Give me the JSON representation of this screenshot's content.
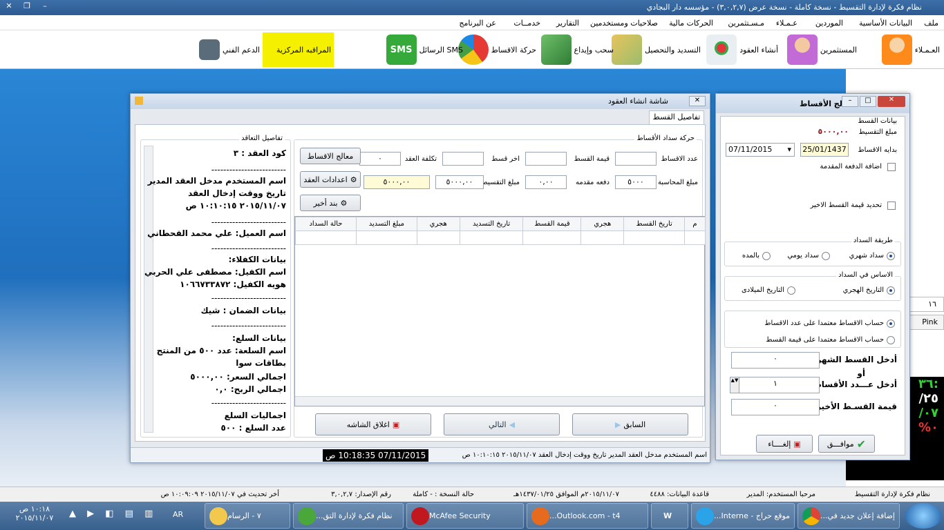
{
  "app": {
    "title": "نظام فكرة لإدارة التقسيط - نسخة كاملة - نسخة عرض (٣,٠,٢,٧) - مؤسسه دار البجادي"
  },
  "menu": [
    "ملف",
    "البيانات الأساسية",
    "الموردين",
    "عـمـلاء",
    "مـسـتثمرين",
    "الحركات مالية",
    "صلاحيات ومستخدمين",
    "التقارير",
    "خدمــات",
    "عن البرنامج"
  ],
  "toolbar": {
    "customers": "العـمـلاء",
    "investors": "المستثمرين",
    "contracts": "أنشاء العقود",
    "payment": "التسديد والتحصيل",
    "withdraw": "سحب وإيداع",
    "installments": "حركة الاقساط",
    "sms": "الرسائل SMS",
    "monitor": "المراقبه المركزية",
    "support": "الدعم الفني",
    "sms_icon": "SMS"
  },
  "contract_window": {
    "title": "شاشة انشاء العقود",
    "tab": "تفاصيل القسط",
    "contract_group": "تفاصيل التعاقد",
    "code": "كود العقد : ٣",
    "sep": "-------------------------",
    "user_label": "اسم المستخدم مدخل العقد المدير",
    "entry_label": "تاريخ ووقت إدخال العقد",
    "entry_time": "٢٠١٥/١١/٠٧ ١٠:١٠:١٥ ص",
    "customer": "اسم العميل: علي محمد القحطاني",
    "guarantors": "بيانات الكفلاء:",
    "guarantor_name": "اسم الكفيل: مصطفى علي الحربي",
    "guarantor_id": "هويه الكفيل: ١٠٦٦٧٣٣٨٧٢",
    "guarantee": "بيانات الضمان : شيك",
    "goods": "بيانات السلع:",
    "goods_name": "اسم السلعة: عدد ٥٠٠ من المنتج",
    "goods_name2": "بطاقات سوا",
    "total_price": "اجمالي السعر: ٥٠٠٠,٠٠",
    "total_profit": "اجمالي الربح: ٠,٠",
    "goods_total": "اجماليات السلع",
    "goods_count": "عدد السلع : ٥٠٠",
    "payments_group": "حركة سداد الأقساط",
    "lbl_count": "عدد الاقساط",
    "lbl_amount": "قيمة القسط",
    "lbl_last": "اخر قسط",
    "lbl_cost": "تكلفة العقد",
    "val_cost": "٠",
    "lbl_accounted": "مبلغ المحاسبة",
    "val_accounted": "٥٠٠٠",
    "lbl_down": "دفعه مقدمه",
    "val_down": "٠,٠٠",
    "lbl_installment_amt": "مبلغ التقسيط",
    "val_installment_amt": "٥٠٠٠,٠٠",
    "val_installment_amt2": "٥٠٠٠,٠٠",
    "btn_wizard": "معالج الاقساط",
    "btn_settings": "اعدادات العقد",
    "btn_additem": "بند أخير",
    "columns": [
      "م",
      "تاريخ القسط",
      "هجري",
      "قيمة القسط",
      "تاريخ التسديد",
      "هجري",
      "مبلغ التسديد",
      "حالة السداد"
    ],
    "btn_prev": "السابق",
    "btn_next": "التالي",
    "btn_close": "اغلاق الشاشه",
    "status": "اسم المستخدم مدخل العقد  المدير  تاريخ ووقت إدخال العقد  ٢٠١٥/١١/٠٧ ١٠:١٠:١٥ ص",
    "status_time": "07/11/2015 10:18:35 ص"
  },
  "wizard": {
    "title": "معالج الأقساط",
    "group": "بيانات القسط",
    "amount_label": "مبلغ التقسيط",
    "amount": "٥٠٠٠,٠٠",
    "start_label": "بدايه الاقساط",
    "hijri": "25/01/1437",
    "date": "07/11/2015",
    "chk_down": "اضافة الدفعة المقدمة",
    "chk_last": "تحديد قيمة القسط الاخير",
    "method_group": "طريقة السداد",
    "monthly": "سداد شهري",
    "daily": "سداد يومي",
    "period": "بالمده",
    "basis_group": "الاساس في السداد",
    "hijri_date": "التاريخ الهجري",
    "greg_date": "التاريخ الميلادى",
    "calc_count": "حساب الاقساط معتمدا على عدد الاقساط",
    "calc_amount": "حساب الاقساط معتمدا على قيمة القسط",
    "monthly_in": "أدخل القسط الشهري",
    "or": "أو",
    "count_in": "أدخل عـــدد الأقساط",
    "last_in": "قيمة القسـط الأخير",
    "val_monthly": "٠",
    "val_count": "١",
    "val_last": "٠",
    "btn_ok": "موافـــق",
    "btn_cancel": "إلغــــاء"
  },
  "side": {
    "num": "١٦",
    "pink": "Pink",
    "clock1": "٣٦:",
    "clock2": "/٢٥",
    "clock3": "/٠٧",
    "clock4": "%٠"
  },
  "statusbar": {
    "app": "نظام فكرة لإدارة التقسيط",
    "welcome": "مرحبا المستخدم: المدير",
    "db": "قاعدة البيانات: ٤٤٨٨",
    "date": "٢٠١٥/١١/٠٧م الموافق ١٤٣٧/٠١/٢٥هـ",
    "copy": "حالة النسخة : - كاملة",
    "version": "رقم الإصدار: ٣,٠,٢,٧",
    "update": "أخر تحديث في ٢٠١٥/١١/٠٧ ١٠:٠٩:٠٩ ص"
  },
  "taskbar": {
    "chrome": "إضافة إعلان جديد في...",
    "ie": "موقع حراج - Interne...",
    "word": "W",
    "outlook": "Outlook.com - t4...",
    "mcafee": "McAfee Security",
    "app": "نظام فكرة لإدارة التق...",
    "paint": "٧ - الرسام",
    "lang": "AR",
    "time": "١٠:١٨ ص",
    "date": "٢٠١٥/١١/٠٧"
  }
}
